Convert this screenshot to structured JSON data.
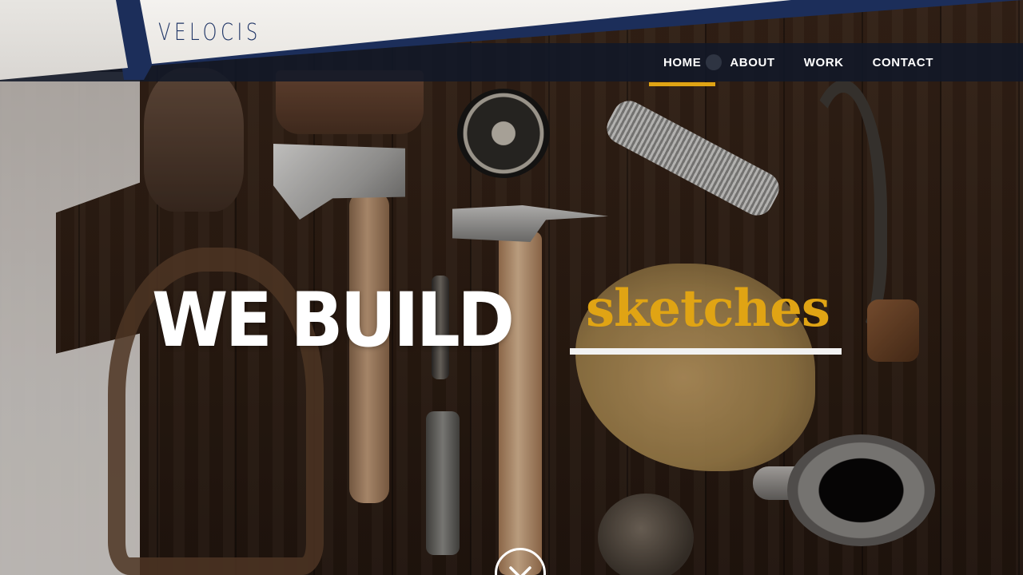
{
  "brand": {
    "logo_text": "VELOCIS"
  },
  "nav": {
    "items": [
      {
        "label": "HOME",
        "active": true
      },
      {
        "label": "ABOUT",
        "active": false
      },
      {
        "label": "WORK",
        "active": false
      },
      {
        "label": "CONTACT",
        "active": false
      }
    ]
  },
  "hero": {
    "headline_prefix": "WE BUILD",
    "headline_word": "sketches",
    "headline_suffix": ".",
    "scroll_icon": "chevron-down-icon"
  },
  "colors": {
    "accent": "#e0a414",
    "brand_blue": "#1c2e5a",
    "nav_background": "#111828",
    "text_light": "#ffffff"
  }
}
